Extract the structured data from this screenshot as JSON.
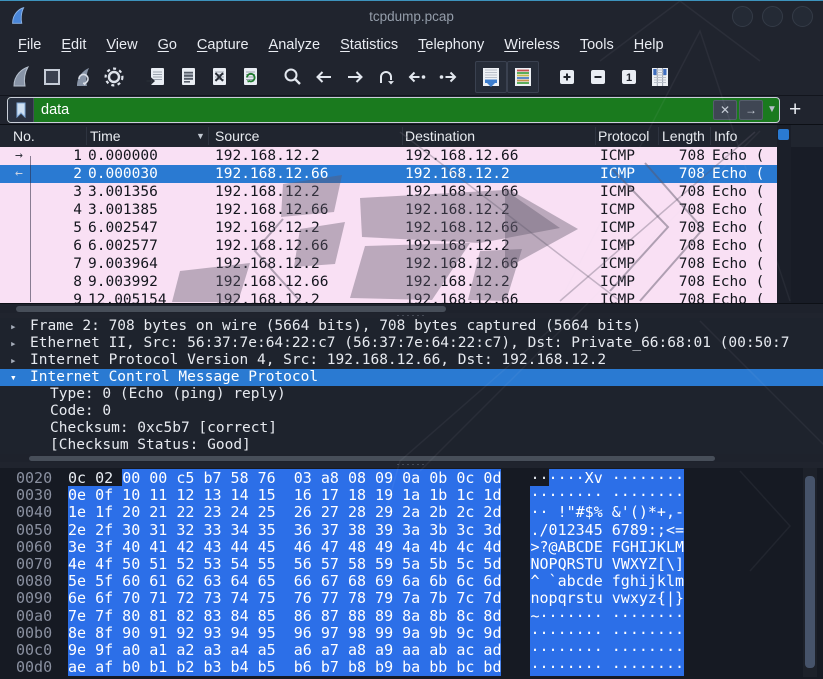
{
  "window": {
    "title": "tcpdump.pcap",
    "logo_icon": "wireshark-fin-icon",
    "buttons": [
      "minimize-button",
      "maximize-button",
      "close-button"
    ]
  },
  "menu": {
    "items": [
      "File",
      "Edit",
      "View",
      "Go",
      "Capture",
      "Analyze",
      "Statistics",
      "Telephony",
      "Wireless",
      "Tools",
      "Help"
    ]
  },
  "toolbar": {
    "icons": [
      "start-capture",
      "stop-capture",
      "restart-capture",
      "capture-options",
      "open-file",
      "save-file",
      "close-file",
      "reload-file",
      "find-packet",
      "go-back",
      "go-forward",
      "go-to-packet",
      "previous-packet",
      "next-packet",
      "auto-scroll",
      "colorize",
      "zoom-in",
      "zoom-out",
      "zoom-original",
      "resize-columns"
    ]
  },
  "filter": {
    "value": "data",
    "clear_label": "✕",
    "apply_label": "→",
    "dropdown_label": "▼",
    "add_label": "+"
  },
  "packet_list": {
    "columns": [
      "No.",
      "Time",
      "Source",
      "Destination",
      "Protocol",
      "Length",
      "Info"
    ],
    "sort_indicator": "▼",
    "rows": [
      {
        "no": "1",
        "time": "0.000000",
        "source": "192.168.12.2",
        "destination": "192.168.12.66",
        "protocol": "ICMP",
        "length": "708",
        "info": "Echo (",
        "selected": false,
        "marker": "request"
      },
      {
        "no": "2",
        "time": "0.000030",
        "source": "192.168.12.66",
        "destination": "192.168.12.2",
        "protocol": "ICMP",
        "length": "708",
        "info": "Echo (",
        "selected": true,
        "marker": "reply"
      },
      {
        "no": "3",
        "time": "3.001356",
        "source": "192.168.12.2",
        "destination": "192.168.12.66",
        "protocol": "ICMP",
        "length": "708",
        "info": "Echo (",
        "selected": false,
        "marker": ""
      },
      {
        "no": "4",
        "time": "3.001385",
        "source": "192.168.12.66",
        "destination": "192.168.12.2",
        "protocol": "ICMP",
        "length": "708",
        "info": "Echo (",
        "selected": false,
        "marker": ""
      },
      {
        "no": "5",
        "time": "6.002547",
        "source": "192.168.12.2",
        "destination": "192.168.12.66",
        "protocol": "ICMP",
        "length": "708",
        "info": "Echo (",
        "selected": false,
        "marker": ""
      },
      {
        "no": "6",
        "time": "6.002577",
        "source": "192.168.12.66",
        "destination": "192.168.12.2",
        "protocol": "ICMP",
        "length": "708",
        "info": "Echo (",
        "selected": false,
        "marker": ""
      },
      {
        "no": "7",
        "time": "9.003964",
        "source": "192.168.12.2",
        "destination": "192.168.12.66",
        "protocol": "ICMP",
        "length": "708",
        "info": "Echo (",
        "selected": false,
        "marker": ""
      },
      {
        "no": "8",
        "time": "9.003992",
        "source": "192.168.12.66",
        "destination": "192.168.12.2",
        "protocol": "ICMP",
        "length": "708",
        "info": "Echo (",
        "selected": false,
        "marker": ""
      },
      {
        "no": "9",
        "time": "12.005154",
        "source": "192.168.12.2",
        "destination": "192.168.12.66",
        "protocol": "ICMP",
        "length": "708",
        "info": "Echo (",
        "selected": false,
        "marker": ""
      }
    ]
  },
  "details": {
    "lines": [
      {
        "state": "collapsed",
        "indent": 0,
        "selected": false,
        "text": "Frame 2: 708 bytes on wire (5664 bits), 708 bytes captured (5664 bits)"
      },
      {
        "state": "collapsed",
        "indent": 0,
        "selected": false,
        "text": "Ethernet II, Src: 56:37:7e:64:22:c7 (56:37:7e:64:22:c7), Dst: Private_66:68:01 (00:50:7"
      },
      {
        "state": "collapsed",
        "indent": 0,
        "selected": false,
        "text": "Internet Protocol Version 4, Src: 192.168.12.66, Dst: 192.168.12.2"
      },
      {
        "state": "expanded",
        "indent": 0,
        "selected": true,
        "text": "Internet Control Message Protocol"
      },
      {
        "state": "none",
        "indent": 1,
        "selected": false,
        "text": "Type: 0 (Echo (ping) reply)"
      },
      {
        "state": "none",
        "indent": 1,
        "selected": false,
        "text": "Code: 0"
      },
      {
        "state": "none",
        "indent": 1,
        "selected": false,
        "text": "Checksum: 0xc5b7 [correct]"
      },
      {
        "state": "none",
        "indent": 1,
        "selected": false,
        "text": "[Checksum Status: Good]"
      }
    ]
  },
  "hex": {
    "rows": [
      {
        "offset": "0020",
        "hex_plain": "0c 02 ",
        "hex_highlighted": "00 00 c5 b7 58 76  03 a8 08 09 0a 0b 0c 0d",
        "ascii_plain": "··",
        "ascii_highlighted": "····Xv ········"
      },
      {
        "offset": "0030",
        "hex_plain": "",
        "hex_highlighted": "0e 0f 10 11 12 13 14 15  16 17 18 19 1a 1b 1c 1d",
        "ascii_plain": "",
        "ascii_highlighted": "········ ········"
      },
      {
        "offset": "0040",
        "hex_plain": "",
        "hex_highlighted": "1e 1f 20 21 22 23 24 25  26 27 28 29 2a 2b 2c 2d",
        "ascii_plain": "",
        "ascii_highlighted": "·· !\"#$% &'()*+,-"
      },
      {
        "offset": "0050",
        "hex_plain": "",
        "hex_highlighted": "2e 2f 30 31 32 33 34 35  36 37 38 39 3a 3b 3c 3d",
        "ascii_plain": "",
        "ascii_highlighted": "./012345 6789:;<="
      },
      {
        "offset": "0060",
        "hex_plain": "",
        "hex_highlighted": "3e 3f 40 41 42 43 44 45  46 47 48 49 4a 4b 4c 4d",
        "ascii_plain": "",
        "ascii_highlighted": ">?@ABCDE FGHIJKLM"
      },
      {
        "offset": "0070",
        "hex_plain": "",
        "hex_highlighted": "4e 4f 50 51 52 53 54 55  56 57 58 59 5a 5b 5c 5d",
        "ascii_plain": "",
        "ascii_highlighted": "NOPQRSTU VWXYZ[\\]"
      },
      {
        "offset": "0080",
        "hex_plain": "",
        "hex_highlighted": "5e 5f 60 61 62 63 64 65  66 67 68 69 6a 6b 6c 6d",
        "ascii_plain": "",
        "ascii_highlighted": "^_`abcde fghijklm"
      },
      {
        "offset": "0090",
        "hex_plain": "",
        "hex_highlighted": "6e 6f 70 71 72 73 74 75  76 77 78 79 7a 7b 7c 7d",
        "ascii_plain": "",
        "ascii_highlighted": "nopqrstu vwxyz{|}"
      },
      {
        "offset": "00a0",
        "hex_plain": "",
        "hex_highlighted": "7e 7f 80 81 82 83 84 85  86 87 88 89 8a 8b 8c 8d",
        "ascii_plain": "",
        "ascii_highlighted": "~······· ········"
      },
      {
        "offset": "00b0",
        "hex_plain": "",
        "hex_highlighted": "8e 8f 90 91 92 93 94 95  96 97 98 99 9a 9b 9c 9d",
        "ascii_plain": "",
        "ascii_highlighted": "········ ········"
      },
      {
        "offset": "00c0",
        "hex_plain": "",
        "hex_highlighted": "9e 9f a0 a1 a2 a3 a4 a5  a6 a7 a8 a9 aa ab ac ad",
        "ascii_plain": "",
        "ascii_highlighted": "········ ········"
      },
      {
        "offset": "00d0",
        "hex_plain": "",
        "hex_highlighted": "ae af b0 b1 b2 b3 b4 b5  b6 b7 b8 b9 ba bb bc bd",
        "ascii_plain": "",
        "ascii_highlighted": "········ ········"
      }
    ]
  },
  "colors": {
    "row_bg": "#f9e0f4",
    "row_text": "#14161e",
    "selection_bg": "#2a7ad2",
    "selection_text": "#ffffff",
    "hex_highlight_bg": "#2c6fe8",
    "filter_valid_bg": "#1a7a1e",
    "accent_blue": "#3f7fce"
  }
}
